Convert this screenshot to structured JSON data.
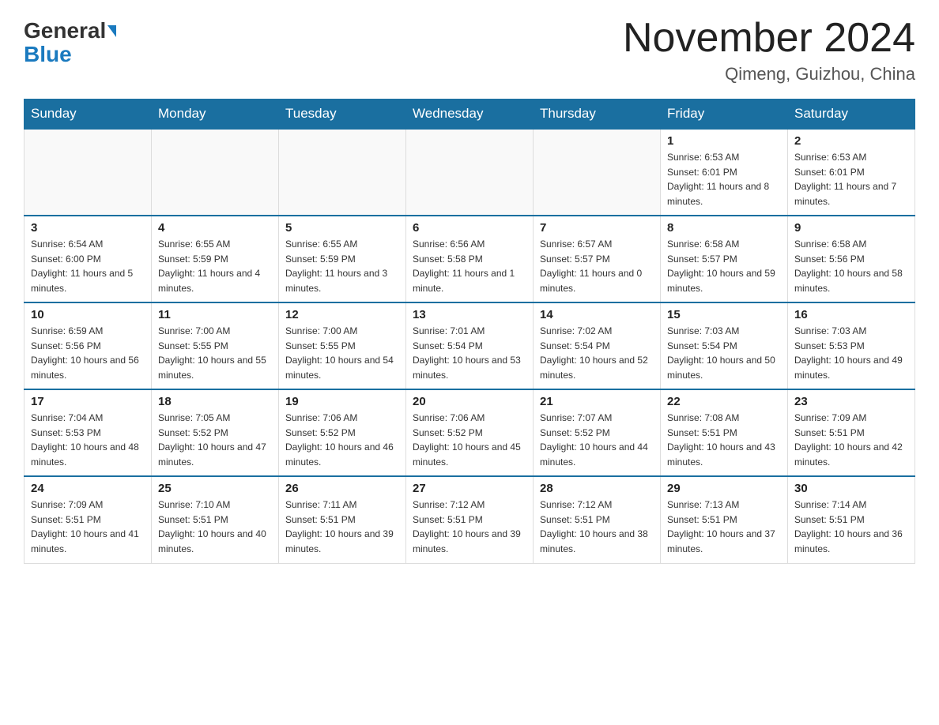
{
  "header": {
    "logo_general": "General",
    "logo_blue": "Blue",
    "title": "November 2024",
    "subtitle": "Qimeng, Guizhou, China"
  },
  "days_of_week": [
    "Sunday",
    "Monday",
    "Tuesday",
    "Wednesday",
    "Thursday",
    "Friday",
    "Saturday"
  ],
  "weeks": [
    [
      {
        "day": "",
        "info": ""
      },
      {
        "day": "",
        "info": ""
      },
      {
        "day": "",
        "info": ""
      },
      {
        "day": "",
        "info": ""
      },
      {
        "day": "",
        "info": ""
      },
      {
        "day": "1",
        "info": "Sunrise: 6:53 AM\nSunset: 6:01 PM\nDaylight: 11 hours and 8 minutes."
      },
      {
        "day": "2",
        "info": "Sunrise: 6:53 AM\nSunset: 6:01 PM\nDaylight: 11 hours and 7 minutes."
      }
    ],
    [
      {
        "day": "3",
        "info": "Sunrise: 6:54 AM\nSunset: 6:00 PM\nDaylight: 11 hours and 5 minutes."
      },
      {
        "day": "4",
        "info": "Sunrise: 6:55 AM\nSunset: 5:59 PM\nDaylight: 11 hours and 4 minutes."
      },
      {
        "day": "5",
        "info": "Sunrise: 6:55 AM\nSunset: 5:59 PM\nDaylight: 11 hours and 3 minutes."
      },
      {
        "day": "6",
        "info": "Sunrise: 6:56 AM\nSunset: 5:58 PM\nDaylight: 11 hours and 1 minute."
      },
      {
        "day": "7",
        "info": "Sunrise: 6:57 AM\nSunset: 5:57 PM\nDaylight: 11 hours and 0 minutes."
      },
      {
        "day": "8",
        "info": "Sunrise: 6:58 AM\nSunset: 5:57 PM\nDaylight: 10 hours and 59 minutes."
      },
      {
        "day": "9",
        "info": "Sunrise: 6:58 AM\nSunset: 5:56 PM\nDaylight: 10 hours and 58 minutes."
      }
    ],
    [
      {
        "day": "10",
        "info": "Sunrise: 6:59 AM\nSunset: 5:56 PM\nDaylight: 10 hours and 56 minutes."
      },
      {
        "day": "11",
        "info": "Sunrise: 7:00 AM\nSunset: 5:55 PM\nDaylight: 10 hours and 55 minutes."
      },
      {
        "day": "12",
        "info": "Sunrise: 7:00 AM\nSunset: 5:55 PM\nDaylight: 10 hours and 54 minutes."
      },
      {
        "day": "13",
        "info": "Sunrise: 7:01 AM\nSunset: 5:54 PM\nDaylight: 10 hours and 53 minutes."
      },
      {
        "day": "14",
        "info": "Sunrise: 7:02 AM\nSunset: 5:54 PM\nDaylight: 10 hours and 52 minutes."
      },
      {
        "day": "15",
        "info": "Sunrise: 7:03 AM\nSunset: 5:54 PM\nDaylight: 10 hours and 50 minutes."
      },
      {
        "day": "16",
        "info": "Sunrise: 7:03 AM\nSunset: 5:53 PM\nDaylight: 10 hours and 49 minutes."
      }
    ],
    [
      {
        "day": "17",
        "info": "Sunrise: 7:04 AM\nSunset: 5:53 PM\nDaylight: 10 hours and 48 minutes."
      },
      {
        "day": "18",
        "info": "Sunrise: 7:05 AM\nSunset: 5:52 PM\nDaylight: 10 hours and 47 minutes."
      },
      {
        "day": "19",
        "info": "Sunrise: 7:06 AM\nSunset: 5:52 PM\nDaylight: 10 hours and 46 minutes."
      },
      {
        "day": "20",
        "info": "Sunrise: 7:06 AM\nSunset: 5:52 PM\nDaylight: 10 hours and 45 minutes."
      },
      {
        "day": "21",
        "info": "Sunrise: 7:07 AM\nSunset: 5:52 PM\nDaylight: 10 hours and 44 minutes."
      },
      {
        "day": "22",
        "info": "Sunrise: 7:08 AM\nSunset: 5:51 PM\nDaylight: 10 hours and 43 minutes."
      },
      {
        "day": "23",
        "info": "Sunrise: 7:09 AM\nSunset: 5:51 PM\nDaylight: 10 hours and 42 minutes."
      }
    ],
    [
      {
        "day": "24",
        "info": "Sunrise: 7:09 AM\nSunset: 5:51 PM\nDaylight: 10 hours and 41 minutes."
      },
      {
        "day": "25",
        "info": "Sunrise: 7:10 AM\nSunset: 5:51 PM\nDaylight: 10 hours and 40 minutes."
      },
      {
        "day": "26",
        "info": "Sunrise: 7:11 AM\nSunset: 5:51 PM\nDaylight: 10 hours and 39 minutes."
      },
      {
        "day": "27",
        "info": "Sunrise: 7:12 AM\nSunset: 5:51 PM\nDaylight: 10 hours and 39 minutes."
      },
      {
        "day": "28",
        "info": "Sunrise: 7:12 AM\nSunset: 5:51 PM\nDaylight: 10 hours and 38 minutes."
      },
      {
        "day": "29",
        "info": "Sunrise: 7:13 AM\nSunset: 5:51 PM\nDaylight: 10 hours and 37 minutes."
      },
      {
        "day": "30",
        "info": "Sunrise: 7:14 AM\nSunset: 5:51 PM\nDaylight: 10 hours and 36 minutes."
      }
    ]
  ]
}
